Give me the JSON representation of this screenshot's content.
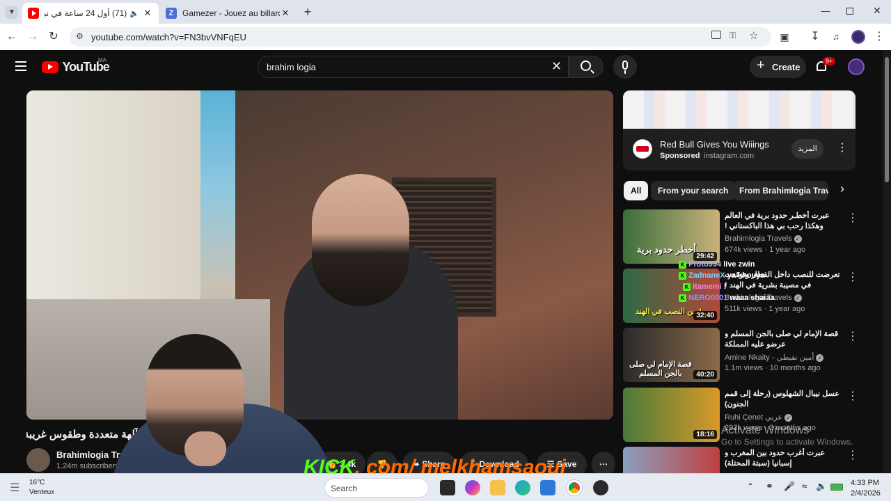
{
  "browser": {
    "tabs": [
      {
        "title": "(71) أول 24 ساعة في نيبال:",
        "favicon_color": "#ff0000"
      },
      {
        "title": "Gamezer - Jouez au billard, aux",
        "favicon_color": "#4a6fd6"
      }
    ],
    "url": "youtube.com/watch?v=FN3bvVNFqEU"
  },
  "youtube": {
    "logo_text": "YouTube",
    "region": "MA",
    "search_value": "brahim logia",
    "create_label": "Create",
    "notifications": "9+",
    "ad": {
      "title": "Red Bull Gives You Wiiings",
      "sponsored": "Sponsored",
      "domain": "instagram.com",
      "cta": "المزيد"
    },
    "chips": [
      "All",
      "From your search",
      "From Brahimlogia Travels"
    ],
    "recommendations": [
      {
        "title": "عبرت أخطـر حدود برية في العالم وهكذا رحب بي هذا الباكستاني ! INPK",
        "channel": "Brahimlogia Travels",
        "verified": true,
        "meta": "674k views · 1 year ago",
        "duration": "29:42",
        "thumb_text": "أخطر حدود برية",
        "colors": [
          "#3b6e3a",
          "#c9b27a"
        ]
      },
      {
        "title": "تعرضت للنصب داخل القطار وتوقعت في مصيبة بشرية في الهند !",
        "channel": "Brahimlogia Travels",
        "verified": true,
        "meta": "511k views · 1 year ago",
        "duration": "32:40",
        "thumb_text": "من النصب في الهند !",
        "colors": [
          "#2d6a44",
          "#b04a3a"
        ]
      },
      {
        "title": "قصة الإمام لي صلى بالجن المسلم و عرضو عليه المملكة",
        "channel": "Amine Nkaity - أمين نقيطي",
        "verified": true,
        "meta": "1.1m views · 10 months ago",
        "duration": "40:20",
        "thumb_text": "قصة الإمام لي صلى بالجن المسلم",
        "colors": [
          "#2a2a2a",
          "#8a6a4a"
        ]
      },
      {
        "title": "عسل نيبال الشهلوس (رحلة إلى قمم الجنون)",
        "channel": "Ruhi Çenet عربي",
        "verified": true,
        "meta": "292k views · 3 months ago",
        "duration": "18:16",
        "thumb_text": "",
        "colors": [
          "#4a7a3a",
          "#d99a2a"
        ]
      },
      {
        "title": "عبرت أغرب حدود بين المغرب و إسبانيا (سبتة المحتلة)",
        "channel": "",
        "verified": false,
        "meta": "",
        "duration": "",
        "thumb_text": "",
        "colors": [
          "#8aa0c0",
          "#c04040"
        ]
      }
    ],
    "video": {
      "title_partial": "آلهة متعددة وطقوس غريبة",
      "channel": "Brahimlogia Travels",
      "subscribers": "1.24m subscribers",
      "likes": "3.4k",
      "share": "Share",
      "download": "Download",
      "save": "Save"
    }
  },
  "overlay": {
    "chat": [
      {
        "user": "Proto994",
        "msg": "live zwin"
      },
      {
        "user": "ZadnaneX",
        "msg": "ya khouya"
      },
      {
        "user": "itamemi",
        "msg": "!"
      },
      {
        "user": "NERO0001",
        "msg": "waaa shaiaa"
      }
    ],
    "stream_watermark_left": "KICK",
    "stream_watermark_right": ". com/ melkhamsaoui",
    "activate_title": "Activate Windows",
    "activate_sub": "Go to Settings to activate Windows."
  },
  "taskbar": {
    "weather_temp": "16°C",
    "weather_desc": "Venteux",
    "search_placeholder": "Search",
    "time": "4:33 PM",
    "date": "2/4/2026"
  }
}
